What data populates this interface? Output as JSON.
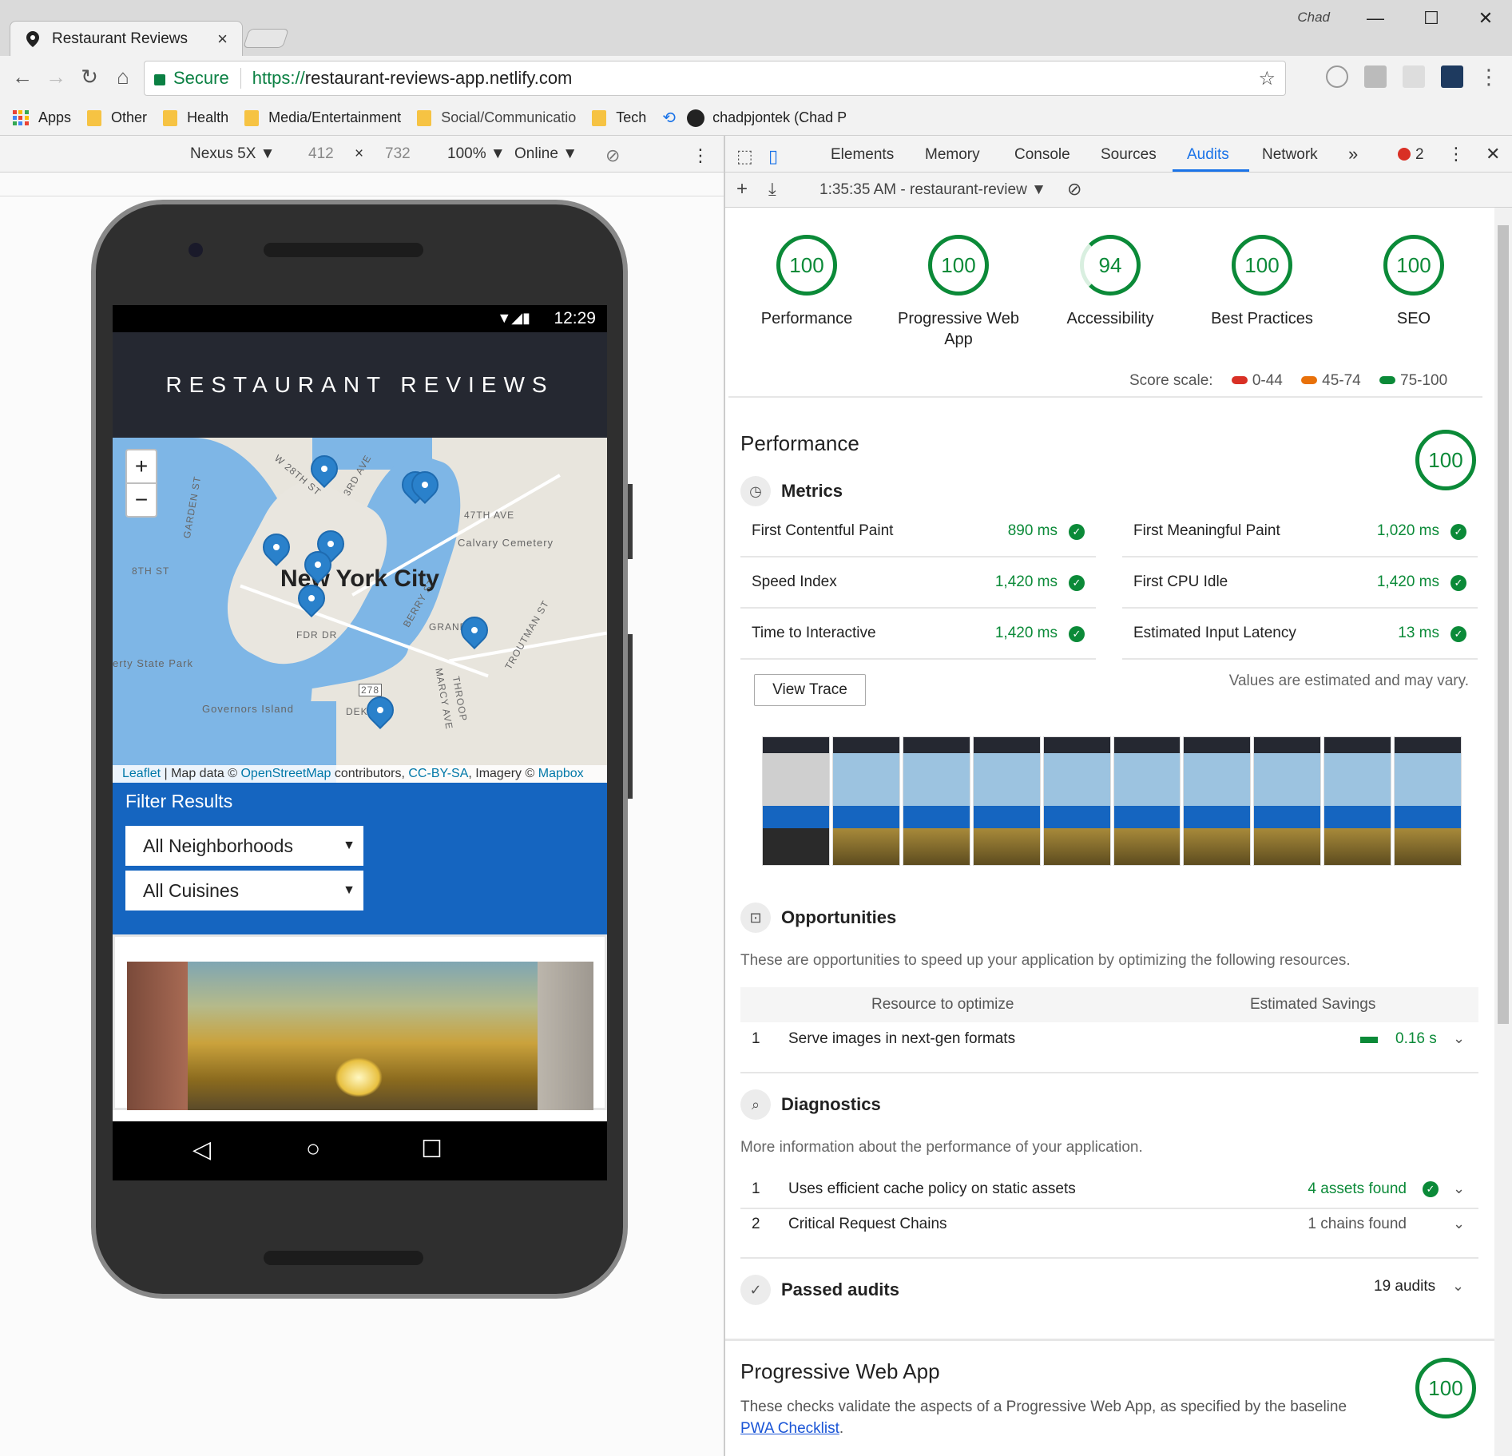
{
  "browser": {
    "tab_title": "Restaurant Reviews",
    "tab_close": "×",
    "user_name": "Chad",
    "window_controls": {
      "minimize": "—",
      "maximize": "☐",
      "close": "✕"
    },
    "url_secure_label": "Secure",
    "url_protocol": "https://",
    "url_host": "restaurant-reviews-app.netlify.com",
    "bookmarks": [
      {
        "label": "Apps",
        "type": "apps"
      },
      {
        "label": "Other",
        "type": "folder"
      },
      {
        "label": "Health",
        "type": "folder"
      },
      {
        "label": "Media/Entertainment",
        "type": "folder"
      },
      {
        "label": "Social/Communicatio",
        "type": "folder"
      },
      {
        "label": "Tech",
        "type": "folder"
      },
      {
        "label": "chadpjontek (Chad P",
        "type": "github"
      }
    ]
  },
  "device_toolbar": {
    "device": "Nexus 5X ▼",
    "width": "412",
    "times": "×",
    "height": "732",
    "zoom": "100% ▼",
    "network": "Online ▼"
  },
  "phone": {
    "status_time": "12:29",
    "app_title": "RESTAURANT REVIEWS",
    "map_city": "New York City",
    "map_attribution": {
      "leaflet": "Leaflet",
      "sep": " | Map data © ",
      "osm": "OpenStreetMap",
      "contrib": " contributors, ",
      "license": "CC-BY-SA",
      "imagery": ", Imagery © ",
      "mapbox": "Mapbox"
    },
    "map_labels": [
      "W 28TH ST",
      "3RD AVE",
      "47TH AVE",
      "Calvary Cemetery",
      "GARDEN ST",
      "8TH ST",
      "BERRY ST",
      "GRAND",
      "FDR DR",
      "erty State Park",
      "Governors Island",
      "DEKA",
      "MARCY AVE",
      "THROOP",
      "TROUTMAN ST",
      "278"
    ],
    "zoom_in": "+",
    "zoom_out": "−",
    "filter_title": "Filter Results",
    "neighborhood_select": "All Neighborhoods",
    "cuisine_select": "All Cuisines",
    "select_arrow": "▼",
    "nav_back": "◁",
    "nav_home": "○",
    "nav_recent": "☐"
  },
  "devtools": {
    "tabs": [
      "Elements",
      "Memory",
      "Console",
      "Sources",
      "Audits",
      "Network"
    ],
    "active_tab": "Audits",
    "more_tabs": "»",
    "error_count": "2",
    "audit_run": "1:35:35 AM - restaurant-review ▼",
    "scores": [
      {
        "value": "100",
        "label": "Performance"
      },
      {
        "value": "100",
        "label": "Progressive Web App"
      },
      {
        "value": "94",
        "label": "Accessibility"
      },
      {
        "value": "100",
        "label": "Best Practices"
      },
      {
        "value": "100",
        "label": "SEO"
      }
    ],
    "score_scale": {
      "label": "Score scale:",
      "low": "0-44",
      "mid": "45-74",
      "high": "75-100",
      "colors": {
        "low": "#d93025",
        "mid": "#e8710a",
        "high": "#0b8a38"
      }
    },
    "performance": {
      "title": "Performance",
      "score": "100",
      "metrics_title": "Metrics",
      "metrics": [
        {
          "name": "First Contentful Paint",
          "value": "890 ms"
        },
        {
          "name": "First Meaningful Paint",
          "value": "1,020 ms"
        },
        {
          "name": "Speed Index",
          "value": "1,420 ms"
        },
        {
          "name": "First CPU Idle",
          "value": "1,420 ms"
        },
        {
          "name": "Time to Interactive",
          "value": "1,420 ms"
        },
        {
          "name": "Estimated Input Latency",
          "value": "13 ms"
        }
      ],
      "view_trace": "View Trace",
      "estimate_note": "Values are estimated and may vary.",
      "opportunities_title": "Opportunities",
      "opportunities_desc": "These are opportunities to speed up your application by optimizing the following resources.",
      "opp_col_resource": "Resource to optimize",
      "opp_col_savings": "Estimated Savings",
      "opportunities": [
        {
          "num": "1",
          "label": "Serve images in next-gen formats",
          "value": "0.16 s"
        }
      ],
      "diagnostics_title": "Diagnostics",
      "diagnostics_desc": "More information about the performance of your application.",
      "diagnostics": [
        {
          "num": "1",
          "label": "Uses efficient cache policy on static assets",
          "value": "4 assets found"
        },
        {
          "num": "2",
          "label": "Critical Request Chains",
          "value": "1 chains found"
        }
      ],
      "passed_title": "Passed audits",
      "passed_count": "19 audits"
    },
    "pwa": {
      "title": "Progressive Web App",
      "score": "100",
      "desc": "These checks validate the aspects of a Progressive Web App, as specified by the baseline",
      "link": "PWA Checklist",
      "period": "."
    }
  }
}
